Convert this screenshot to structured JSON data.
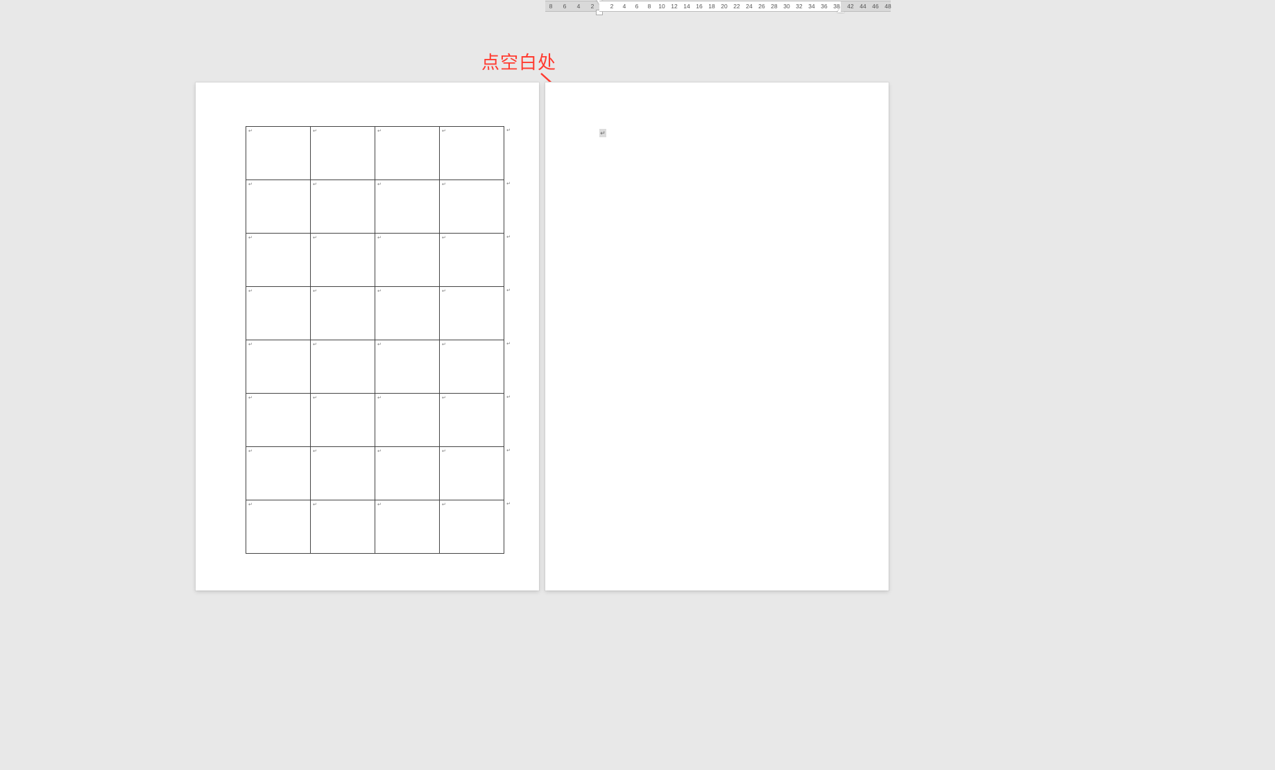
{
  "ruler": {
    "left_gray_labels": [
      "8",
      "6",
      "4",
      "2"
    ],
    "right_gray_labels": [
      "42",
      "44",
      "46",
      "48"
    ],
    "white_labels": [
      "2",
      "4",
      "6",
      "8",
      "10",
      "12",
      "14",
      "16",
      "18",
      "20",
      "22",
      "24",
      "26",
      "28",
      "30",
      "32",
      "34",
      "36",
      "38"
    ]
  },
  "annotation": {
    "text": "点空白处"
  },
  "table": {
    "rows": 8,
    "cols": 4,
    "cell_mark": "↵",
    "end_mark": "↵"
  },
  "page2": {
    "para_mark": "↵"
  }
}
